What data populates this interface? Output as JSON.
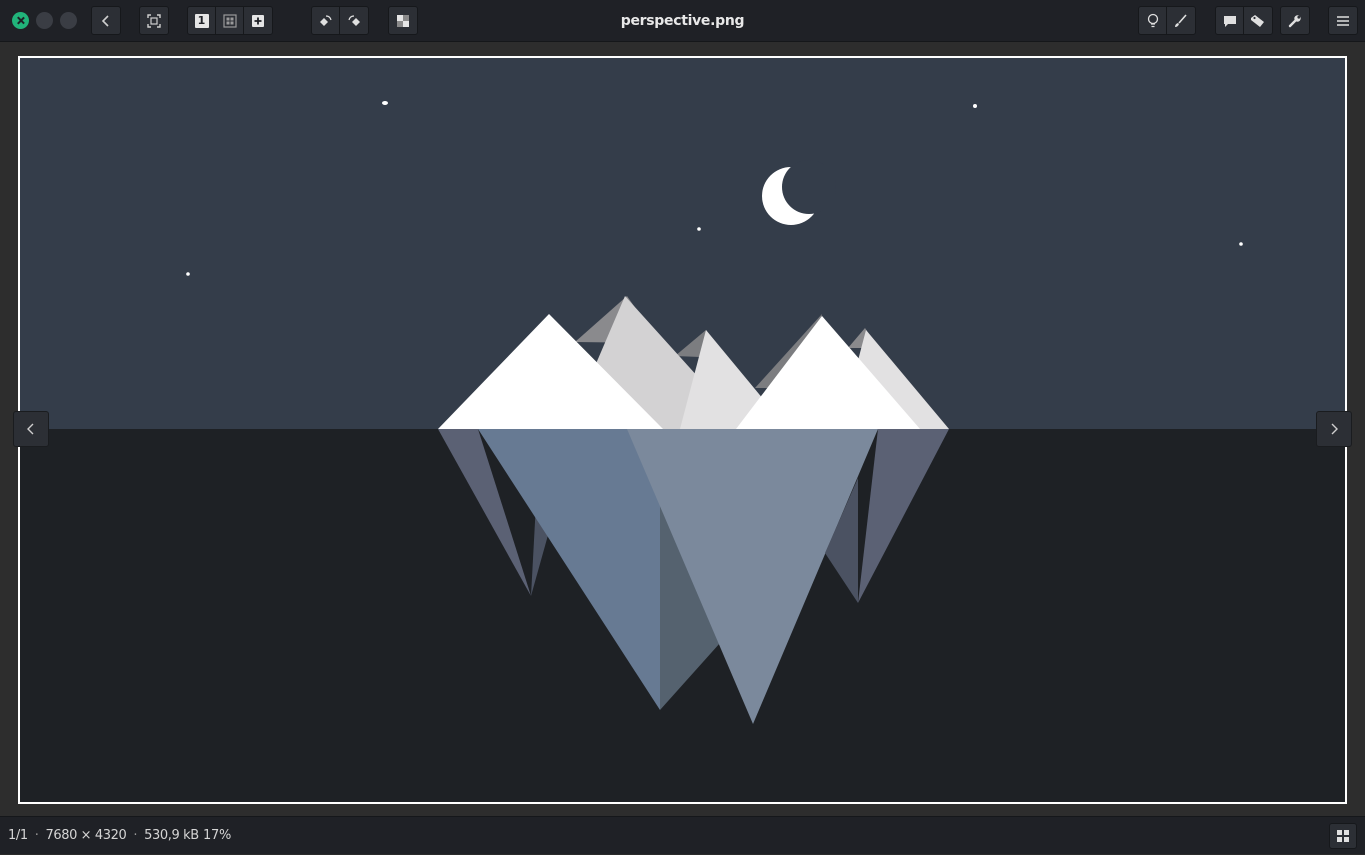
{
  "window": {
    "title": "perspective.png",
    "controls": [
      "close",
      "minimize",
      "maximize"
    ]
  },
  "toolbar": {
    "left": [
      {
        "name": "back",
        "icon": "chevron-left-icon"
      },
      {
        "name": "fit-to-window",
        "icon": "fit-icon"
      },
      {
        "name": "view-mode-group",
        "items": [
          {
            "name": "single-view",
            "icon": "single-view-icon",
            "label": "1"
          },
          {
            "name": "gallery-view",
            "icon": "grid-view-icon"
          },
          {
            "name": "add",
            "icon": "plus-icon"
          }
        ]
      },
      {
        "name": "rotate-group",
        "items": [
          {
            "name": "rotate-left",
            "icon": "rotate-left-icon"
          },
          {
            "name": "rotate-right",
            "icon": "rotate-right-icon"
          }
        ]
      },
      {
        "name": "transparency",
        "icon": "checkerboard-icon"
      }
    ],
    "right": [
      {
        "name": "adjust-group",
        "items": [
          {
            "name": "lightbulb",
            "icon": "lightbulb-icon"
          },
          {
            "name": "edit",
            "icon": "brush-icon"
          }
        ]
      },
      {
        "name": "annotate-group",
        "items": [
          {
            "name": "comment",
            "icon": "comment-icon"
          },
          {
            "name": "tag",
            "icon": "tag-icon"
          }
        ]
      },
      {
        "name": "tools",
        "icon": "wrench-icon"
      },
      {
        "name": "menu",
        "icon": "hamburger-icon"
      }
    ]
  },
  "navigation": {
    "prev_icon": "chevron-left-icon",
    "next_icon": "chevron-right-icon"
  },
  "status": {
    "position": "1/1",
    "dimensions": "7680 × 4320",
    "file_size": "530,9 kB",
    "separator": "·",
    "zoom": "17%",
    "gallery_icon": "gallery-icon"
  },
  "colors": {
    "chrome_bg": "#1f2126",
    "button_bg": "#2c2f35",
    "close_accent": "#21b37a",
    "sky": "#343d4a",
    "water": "#1e2125",
    "text": "#e8e8e8"
  }
}
